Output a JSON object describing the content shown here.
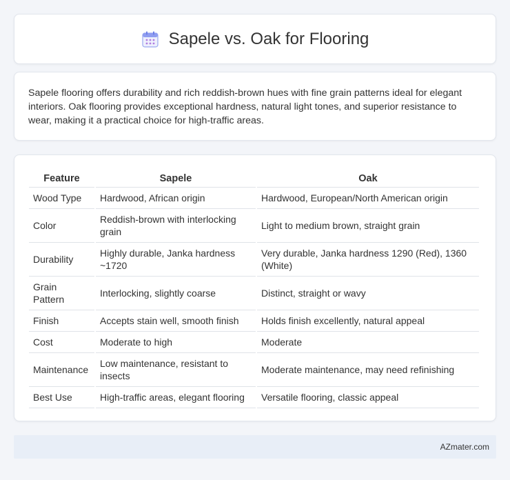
{
  "header": {
    "title": "Sapele vs. Oak for Flooring",
    "icon": "calendar-icon",
    "icon_color": "#8fa7f0"
  },
  "description": "Sapele flooring offers durability and rich reddish-brown hues with fine grain patterns ideal for elegant interiors. Oak flooring provides exceptional hardness, natural light tones, and superior resistance to wear, making it a practical choice for high-traffic areas.",
  "table": {
    "headers": [
      "Feature",
      "Sapele",
      "Oak"
    ],
    "rows": [
      [
        "Wood Type",
        "Hardwood, African origin",
        "Hardwood, European/North American origin"
      ],
      [
        "Color",
        "Reddish-brown with interlocking grain",
        "Light to medium brown, straight grain"
      ],
      [
        "Durability",
        "Highly durable, Janka hardness ~1720",
        "Very durable, Janka hardness 1290 (Red), 1360 (White)"
      ],
      [
        "Grain Pattern",
        "Interlocking, slightly coarse",
        "Distinct, straight or wavy"
      ],
      [
        "Finish",
        "Accepts stain well, smooth finish",
        "Holds finish excellently, natural appeal"
      ],
      [
        "Cost",
        "Moderate to high",
        "Moderate"
      ],
      [
        "Maintenance",
        "Low maintenance, resistant to insects",
        "Moderate maintenance, may need refinishing"
      ],
      [
        "Best Use",
        "High-traffic areas, elegant flooring",
        "Versatile flooring, classic appeal"
      ]
    ]
  },
  "footer": {
    "text": "AZmater.com"
  }
}
